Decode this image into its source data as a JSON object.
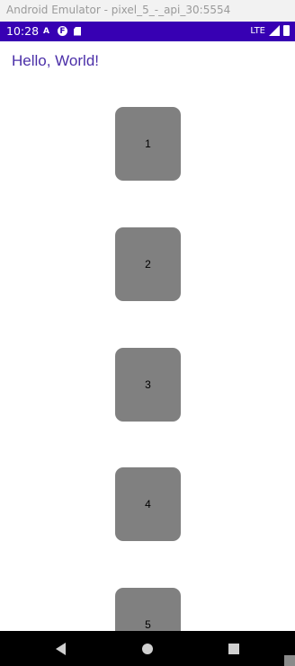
{
  "window": {
    "title": "Android Emulator - pixel_5_-_api_30:5554"
  },
  "status_bar": {
    "time": "10:28",
    "left_icons": [
      "a-notification-icon",
      "circle-f-icon",
      "sd-card-icon"
    ],
    "network": "LTE",
    "signal_icon": "signal-icon",
    "battery_icon": "battery-icon",
    "color": "#3700b3"
  },
  "app": {
    "title": "Hello, World!",
    "title_color": "#4b2fa8"
  },
  "tiles": {
    "color": "#808080",
    "items": [
      {
        "label": "1"
      },
      {
        "label": "2"
      },
      {
        "label": "3"
      },
      {
        "label": "4"
      },
      {
        "label": "5"
      }
    ]
  },
  "nav_bar": {
    "buttons": [
      "back-icon",
      "home-icon",
      "recents-icon"
    ]
  }
}
